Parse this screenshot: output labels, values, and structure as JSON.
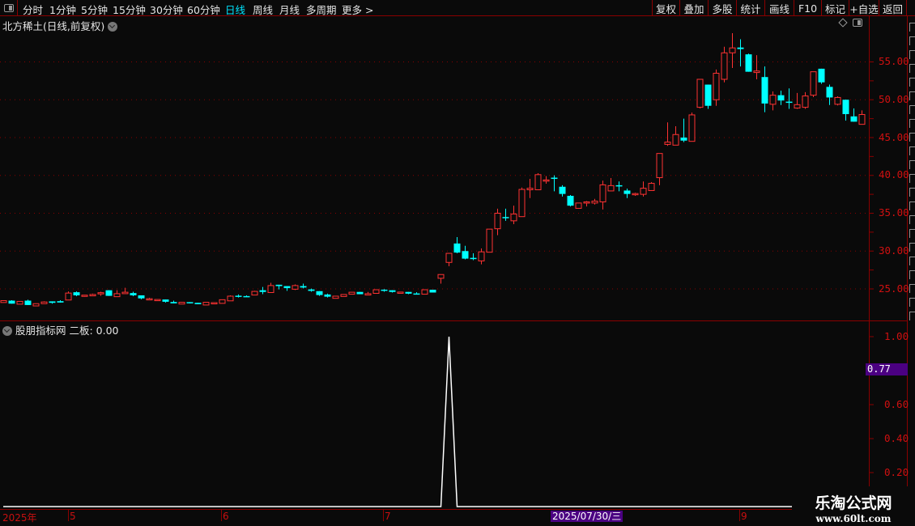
{
  "toolbar": {
    "periods": [
      "分时",
      "1分钟",
      "5分钟",
      "15分钟",
      "30分钟",
      "60分钟",
      "日线",
      "周线",
      "月线",
      "多周期",
      "更多 >"
    ],
    "active_period": "日线",
    "buttons": [
      "复权",
      "叠加",
      "多股",
      "统计",
      "画线",
      "F10",
      "标记",
      "+自选",
      "返回"
    ]
  },
  "main_chart": {
    "title": "北方稀土(日线,前复权)",
    "icons": [
      "chevron-down-icon",
      "diamond-icon",
      "layout-toggle-icon"
    ]
  },
  "indicator": {
    "title": "股朋指标网 二板: 0.00",
    "crosshair_value": "0.77"
  },
  "time_axis": {
    "labels": [
      "2025年",
      "5",
      "6",
      "7",
      "9"
    ],
    "crosshair_date": "2025/07/30/三"
  },
  "watermark": {
    "line1": "乐淘公式网",
    "line2": "www.60lt.com"
  },
  "colors": {
    "up": "#ff3232",
    "down": "#00ffff",
    "grid": "#8b0000",
    "axis_text": "#d01010",
    "indicator_line": "#ffffff",
    "highlight": "#4b0082"
  },
  "chart_data": [
    {
      "type": "candlestick",
      "title": "北方稀土(日线,前复权)",
      "ohlc_order": [
        "open",
        "close",
        "high",
        "low"
      ],
      "y_ticks": [
        "25.00",
        "30.00",
        "35.00",
        "40.00",
        "45.00",
        "50.00",
        "55.00"
      ],
      "ylim": [
        21,
        60
      ],
      "grid": true,
      "candles": [
        [
          23.2,
          23.45,
          23.45,
          23.2
        ],
        [
          23.45,
          23.05,
          23.5,
          23.05
        ],
        [
          22.98,
          23.35,
          23.35,
          22.98
        ],
        [
          23.45,
          22.87,
          23.57,
          22.87
        ],
        [
          22.75,
          23.05,
          23.05,
          22.75
        ],
        [
          23.05,
          23.27,
          23.35,
          23.05
        ],
        [
          23.35,
          23.16,
          23.35,
          23.05
        ],
        [
          23.38,
          23.2,
          23.5,
          23.2
        ],
        [
          23.53,
          24.45,
          24.67,
          23.53
        ],
        [
          24.56,
          24.15,
          24.67,
          24.04
        ],
        [
          24.13,
          24.17,
          24.17,
          23.97
        ],
        [
          24.08,
          24.26,
          24.37,
          24.08
        ],
        [
          24.45,
          24.5,
          24.63,
          24.08
        ],
        [
          24.82,
          24.08,
          24.82,
          24.08
        ],
        [
          23.97,
          24.37,
          24.82,
          23.97
        ],
        [
          24.37,
          24.56,
          25.15,
          24.37
        ],
        [
          24.45,
          24.15,
          24.63,
          24.04
        ],
        [
          24.15,
          23.75,
          24.15,
          23.64
        ],
        [
          23.65,
          23.7,
          23.82,
          23.53
        ],
        [
          23.55,
          23.6,
          23.6,
          23.55
        ],
        [
          23.6,
          23.3,
          23.6,
          23.2
        ],
        [
          23.27,
          23.09,
          23.45,
          23.09
        ],
        [
          23.0,
          23.23,
          23.23,
          23.0
        ],
        [
          23.25,
          23.2,
          23.25,
          23.09
        ],
        [
          23.16,
          22.98,
          23.16,
          22.98
        ],
        [
          22.87,
          23.23,
          23.23,
          22.87
        ],
        [
          23.15,
          23.18,
          23.18,
          23.15
        ],
        [
          23.09,
          23.57,
          23.57,
          23.09
        ],
        [
          23.42,
          24.04,
          24.15,
          23.42
        ],
        [
          24.1,
          24.05,
          24.26,
          23.86
        ],
        [
          24.05,
          24.0,
          24.15,
          23.97
        ],
        [
          24.19,
          24.67,
          24.74,
          24.19
        ],
        [
          24.82,
          24.6,
          25.26,
          24.3
        ],
        [
          24.52,
          25.44,
          25.8,
          24.52
        ],
        [
          25.55,
          25.37,
          25.55,
          24.93
        ],
        [
          25.37,
          25.1,
          25.37,
          24.74
        ],
        [
          24.96,
          25.44,
          25.59,
          24.85
        ],
        [
          25.37,
          25.18,
          25.7,
          25.07
        ],
        [
          24.93,
          24.74,
          25.04,
          24.63
        ],
        [
          24.7,
          24.19,
          24.7,
          24.08
        ],
        [
          24.26,
          23.97,
          24.37,
          23.86
        ],
        [
          23.75,
          24.04,
          24.04,
          23.75
        ],
        [
          24.0,
          24.26,
          24.26,
          24.0
        ],
        [
          24.3,
          24.56,
          24.56,
          24.3
        ],
        [
          24.6,
          24.3,
          24.6,
          24.3
        ],
        [
          24.19,
          24.37,
          24.6,
          24.19
        ],
        [
          24.41,
          24.89,
          24.89,
          24.41
        ],
        [
          24.9,
          24.85,
          24.96,
          24.63
        ],
        [
          24.82,
          24.6,
          24.82,
          24.52
        ],
        [
          24.54,
          24.58,
          24.58,
          24.45
        ],
        [
          24.6,
          24.37,
          24.6,
          24.3
        ],
        [
          24.4,
          24.35,
          24.56,
          24.35
        ],
        [
          24.3,
          24.89,
          24.89,
          24.3
        ],
        [
          24.89,
          24.52,
          24.89,
          24.52
        ],
        [
          26.4,
          26.9,
          26.9,
          25.7
        ],
        [
          28.5,
          29.7,
          29.7,
          28.0
        ],
        [
          31.0,
          29.8,
          31.85,
          29.7
        ],
        [
          30.0,
          29.0,
          30.7,
          28.9
        ],
        [
          29.1,
          29.0,
          29.7,
          28.8
        ],
        [
          28.7,
          29.9,
          30.35,
          28.25
        ],
        [
          29.85,
          32.9,
          32.9,
          29.85
        ],
        [
          32.95,
          35.0,
          35.6,
          32.1
        ],
        [
          34.5,
          34.4,
          35.6,
          34.0
        ],
        [
          34.0,
          34.9,
          36.0,
          33.55
        ],
        [
          34.55,
          38.15,
          38.4,
          34.55
        ],
        [
          38.1,
          38.3,
          39.55,
          37.0
        ],
        [
          38.1,
          40.1,
          40.3,
          38.1
        ],
        [
          39.3,
          39.4,
          39.9,
          38.9
        ],
        [
          39.7,
          39.6,
          40.0,
          37.9
        ],
        [
          38.5,
          37.55,
          38.7,
          37.2
        ],
        [
          37.3,
          36.0,
          37.4,
          35.9
        ],
        [
          35.65,
          36.35,
          36.35,
          35.65
        ],
        [
          36.4,
          36.5,
          36.6,
          35.9
        ],
        [
          36.35,
          36.6,
          36.9,
          36.15
        ],
        [
          36.5,
          38.75,
          39.3,
          35.5
        ],
        [
          37.95,
          38.65,
          39.65,
          37.9
        ],
        [
          38.7,
          38.6,
          39.2,
          37.9
        ],
        [
          38.0,
          37.55,
          38.25,
          37.0
        ],
        [
          37.5,
          37.6,
          37.7,
          37.3
        ],
        [
          37.5,
          38.3,
          39.2,
          37.2
        ],
        [
          38.0,
          38.95,
          39.1,
          38.0
        ],
        [
          39.7,
          42.9,
          42.9,
          38.7
        ],
        [
          44.1,
          44.4,
          47.0,
          43.9
        ],
        [
          44.0,
          45.4,
          46.5,
          44.0
        ],
        [
          45.0,
          44.6,
          47.5,
          44.4
        ],
        [
          44.5,
          48.0,
          48.3,
          44.5
        ],
        [
          49.0,
          52.7,
          52.7,
          48.85
        ],
        [
          52.0,
          49.2,
          52.0,
          48.8
        ],
        [
          50.0,
          53.5,
          54.0,
          49.2
        ],
        [
          52.7,
          56.2,
          57.0,
          52.3
        ],
        [
          56.2,
          56.85,
          58.8,
          54.2
        ],
        [
          56.9,
          56.7,
          58.0,
          54.4
        ],
        [
          56.0,
          53.7,
          56.1,
          53.7
        ],
        [
          53.6,
          53.8,
          55.9,
          52.7
        ],
        [
          53.0,
          49.5,
          54.4,
          48.35
        ],
        [
          49.4,
          50.6,
          51.1,
          48.6
        ],
        [
          50.6,
          49.9,
          51.2,
          49.3
        ],
        [
          49.75,
          49.65,
          51.5,
          48.8
        ],
        [
          48.9,
          49.35,
          50.9,
          48.8
        ],
        [
          49.0,
          50.5,
          51.0,
          48.8
        ],
        [
          50.6,
          53.7,
          53.7,
          50.35
        ],
        [
          54.1,
          52.3,
          54.1,
          52.1
        ],
        [
          51.7,
          50.3,
          52.0,
          49.3
        ],
        [
          49.4,
          50.3,
          50.45,
          49.25
        ],
        [
          50.0,
          48.1,
          50.0,
          47.25
        ],
        [
          47.8,
          47.1,
          48.85,
          47.1
        ],
        [
          46.75,
          48.05,
          48.6,
          46.75
        ]
      ]
    },
    {
      "type": "line",
      "title": "股朋指标网 二板: 0.00",
      "y_ticks": [
        "0.20",
        "0.40",
        "0.60",
        "1.00"
      ],
      "ylim": [
        0,
        1.05
      ],
      "series": [
        {
          "name": "二板",
          "values": [
            0,
            0,
            0,
            0,
            0,
            0,
            0,
            0,
            0,
            0,
            0,
            0,
            0,
            0,
            0,
            0,
            0,
            0,
            0,
            0,
            0,
            0,
            0,
            0,
            0,
            0,
            0,
            0,
            0,
            0,
            0,
            0,
            0,
            0,
            0,
            0,
            0,
            0,
            0,
            0,
            0,
            0,
            0,
            0,
            0,
            0,
            0,
            0,
            0,
            0,
            0,
            0,
            0,
            0,
            0,
            1,
            0,
            0,
            0,
            0,
            0,
            0,
            0,
            0,
            0,
            0,
            0,
            0,
            0,
            0,
            0,
            0,
            0,
            0,
            0,
            0,
            0,
            0,
            0,
            0,
            0,
            0,
            0,
            0,
            0,
            0,
            0,
            0,
            0,
            0,
            0,
            0,
            0,
            0,
            0,
            0,
            0,
            0,
            0,
            0,
            0,
            0,
            0,
            0,
            0,
            0,
            0
          ]
        }
      ]
    }
  ]
}
